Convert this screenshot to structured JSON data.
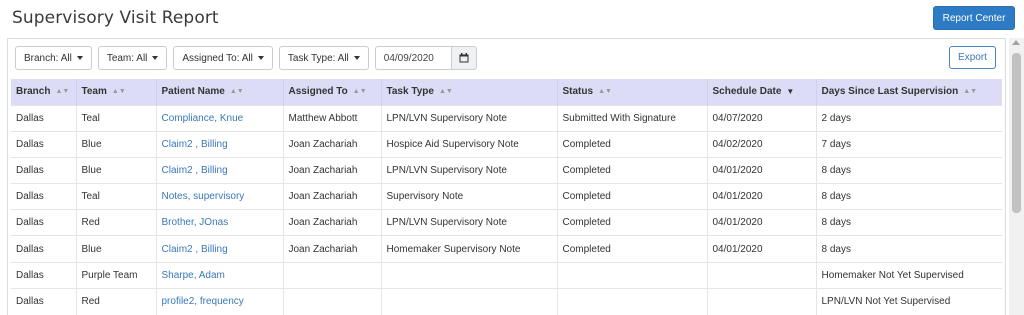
{
  "header": {
    "title": "Supervisory Visit Report",
    "report_center_label": "Report Center"
  },
  "filters": {
    "branch": "Branch: All",
    "team": "Team: All",
    "assigned_to": "Assigned To: All",
    "task_type": "Task Type: All",
    "date_value": "04/09/2020",
    "export_label": "Export"
  },
  "table": {
    "columns": [
      "Branch",
      "Team",
      "Patient Name",
      "Assigned To",
      "Task Type",
      "Status",
      "Schedule Date",
      "Days Since Last Supervision"
    ],
    "sorted_column": "Schedule Date",
    "rows": [
      {
        "branch": "Dallas",
        "team": "Teal",
        "patient": "Compliance, Knue",
        "assigned": "Matthew Abbott",
        "task": "LPN/LVN Supervisory Note",
        "status": "Submitted With Signature",
        "date": "04/07/2020",
        "days": "2 days"
      },
      {
        "branch": "Dallas",
        "team": "Blue",
        "patient": "Claim2 , Billing",
        "assigned": "Joan Zachariah",
        "task": "Hospice Aid Supervisory Note",
        "status": "Completed",
        "date": "04/02/2020",
        "days": "7 days"
      },
      {
        "branch": "Dallas",
        "team": "Blue",
        "patient": "Claim2 , Billing",
        "assigned": "Joan Zachariah",
        "task": "LPN/LVN Supervisory Note",
        "status": "Completed",
        "date": "04/01/2020",
        "days": "8 days"
      },
      {
        "branch": "Dallas",
        "team": "Teal",
        "patient": "Notes, supervisory",
        "assigned": "Joan Zachariah",
        "task": "Supervisory Note",
        "status": "Completed",
        "date": "04/01/2020",
        "days": "8 days"
      },
      {
        "branch": "Dallas",
        "team": "Red",
        "patient": "Brother, JOnas",
        "assigned": "Joan Zachariah",
        "task": "LPN/LVN Supervisory Note",
        "status": "Completed",
        "date": "04/01/2020",
        "days": "8 days"
      },
      {
        "branch": "Dallas",
        "team": "Blue",
        "patient": "Claim2 , Billing",
        "assigned": "Joan Zachariah",
        "task": "Homemaker Supervisory Note",
        "status": "Completed",
        "date": "04/01/2020",
        "days": "8 days"
      },
      {
        "branch": "Dallas",
        "team": "Purple Team",
        "patient": "Sharpe, Adam",
        "assigned": "",
        "task": "",
        "status": "",
        "date": "",
        "days": "Homemaker Not Yet Supervised"
      },
      {
        "branch": "Dallas",
        "team": "Red",
        "patient": "profile2, frequency",
        "assigned": "",
        "task": "",
        "status": "",
        "date": "",
        "days": "LPN/LVN Not Yet Supervised"
      }
    ]
  },
  "icons": {
    "calendar": "calendar-icon",
    "sort": "sort-icon",
    "sort_desc": "sort-desc-icon"
  },
  "colors": {
    "primary": "#2d7bc4",
    "link": "#3a78b8",
    "header_row": "#dcdcf7"
  }
}
